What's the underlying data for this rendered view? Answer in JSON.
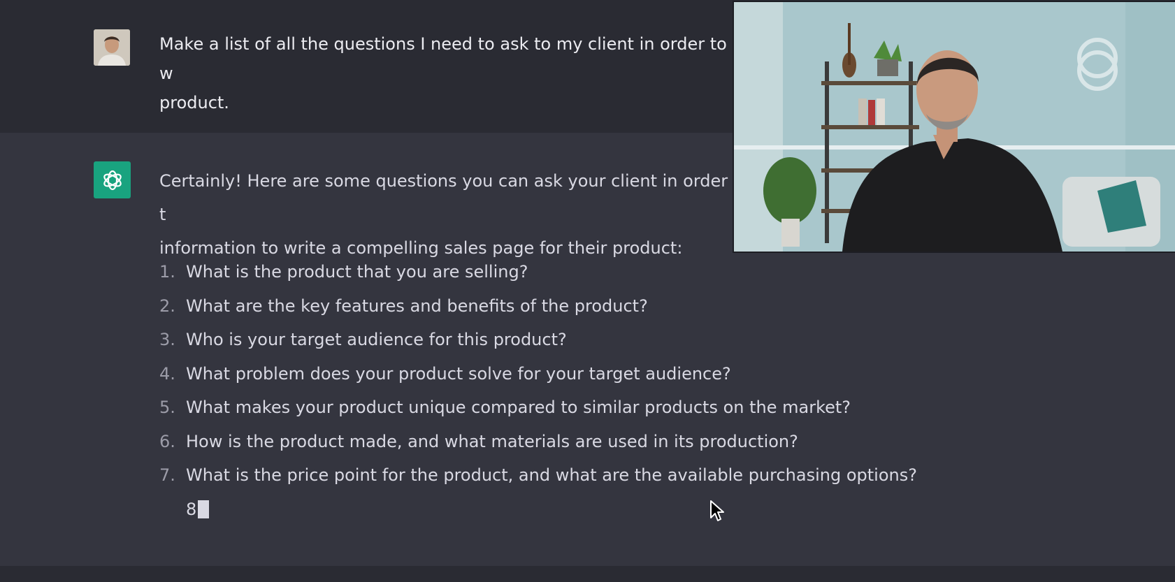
{
  "user_message": {
    "text": "Make a list of all the questions I need to ask to my client in order to w",
    "text_line2": "product."
  },
  "assistant_message": {
    "intro_line1": "Certainly! Here are some questions you can ask your client in order t",
    "intro_line2": "information to write a compelling sales page for their product:",
    "questions": [
      {
        "num": "1.",
        "text": "What is the product that you are selling?"
      },
      {
        "num": "2.",
        "text": "What are the key features and benefits of the product?"
      },
      {
        "num": "3.",
        "text": "Who is your target audience for this product?"
      },
      {
        "num": "4.",
        "text": "What problem does your product solve for your target audience?"
      },
      {
        "num": "5.",
        "text": "What makes your product unique compared to similar products on the market?"
      },
      {
        "num": "6.",
        "text": "How is the product made, and what materials are used in its production?"
      },
      {
        "num": "7.",
        "text": "What is the price point for the product, and what are the available purchasing options?"
      }
    ],
    "partial": "8"
  },
  "icons": {
    "assistant_avatar": "openai-logo-icon",
    "user_avatar": "user-photo",
    "cursor": "mouse-pointer-icon",
    "webcam_watermark": "brand-watermark-icon"
  },
  "colors": {
    "user_row_bg": "#2a2b33",
    "assistant_row_bg": "#34353f",
    "assistant_avatar_bg": "#19a37f",
    "text": "#d9d9e3"
  }
}
